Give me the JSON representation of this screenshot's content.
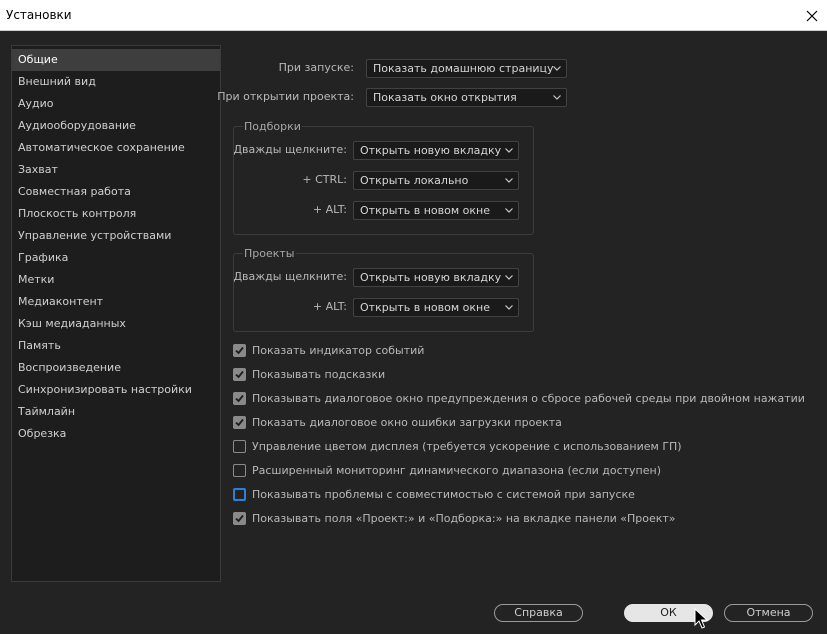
{
  "window": {
    "title": "Установки"
  },
  "sidebar": {
    "items": [
      "Общие",
      "Внешний вид",
      "Аудио",
      "Аудиооборудование",
      "Автоматическое сохранение",
      "Захват",
      "Совместная работа",
      "Плоскость контроля",
      "Управление устройствами",
      "Графика",
      "Метки",
      "Медиаконтент",
      "Кэш медиаданных",
      "Память",
      "Воспроизведение",
      "Синхронизировать настройки",
      "Таймлайн",
      "Обрезка"
    ],
    "active_index": 0
  },
  "general": {
    "startup_label": "При запуске:",
    "startup_value": "Показать домашнюю страницу",
    "open_project_label": "При открытии проекта:",
    "open_project_value": "Показать окно открытия"
  },
  "bins": {
    "title": "Подборки",
    "double_click_label": "Дважды щелкните:",
    "double_click_value": "Открыть новую вкладку",
    "ctrl_label": "+ CTRL:",
    "ctrl_value": "Открыть локально",
    "alt_label": "+ ALT:",
    "alt_value": "Открыть в новом окне"
  },
  "projects": {
    "title": "Проекты",
    "double_click_label": "Дважды щелкните:",
    "double_click_value": "Открыть новую вкладку",
    "alt_label": "+ ALT:",
    "alt_value": "Открыть в новом окне"
  },
  "checkboxes": [
    {
      "label": "Показать индикатор событий",
      "state": "checked"
    },
    {
      "label": "Показывать подсказки",
      "state": "checked"
    },
    {
      "label": "Показывать диалоговое окно предупреждения о сбросе рабочей среды при двойном нажатии",
      "state": "checked"
    },
    {
      "label": "Показать диалоговое окно ошибки загрузки проекта",
      "state": "checked"
    },
    {
      "label": "Управление цветом дисплея (требуется ускорение с использованием ГП)",
      "state": "unchecked"
    },
    {
      "label": "Расширенный мониторинг динамического диапазона (если доступен)",
      "state": "unchecked"
    },
    {
      "label": "Показывать проблемы с совместимостью с системой при запуске",
      "state": "focused"
    },
    {
      "label": "Показывать поля «Проект:» и «Подборка:» на вкладке панели «Проект»",
      "state": "checked"
    }
  ],
  "buttons": {
    "help": "Справка",
    "ok": "ОК",
    "cancel": "Отмена"
  }
}
